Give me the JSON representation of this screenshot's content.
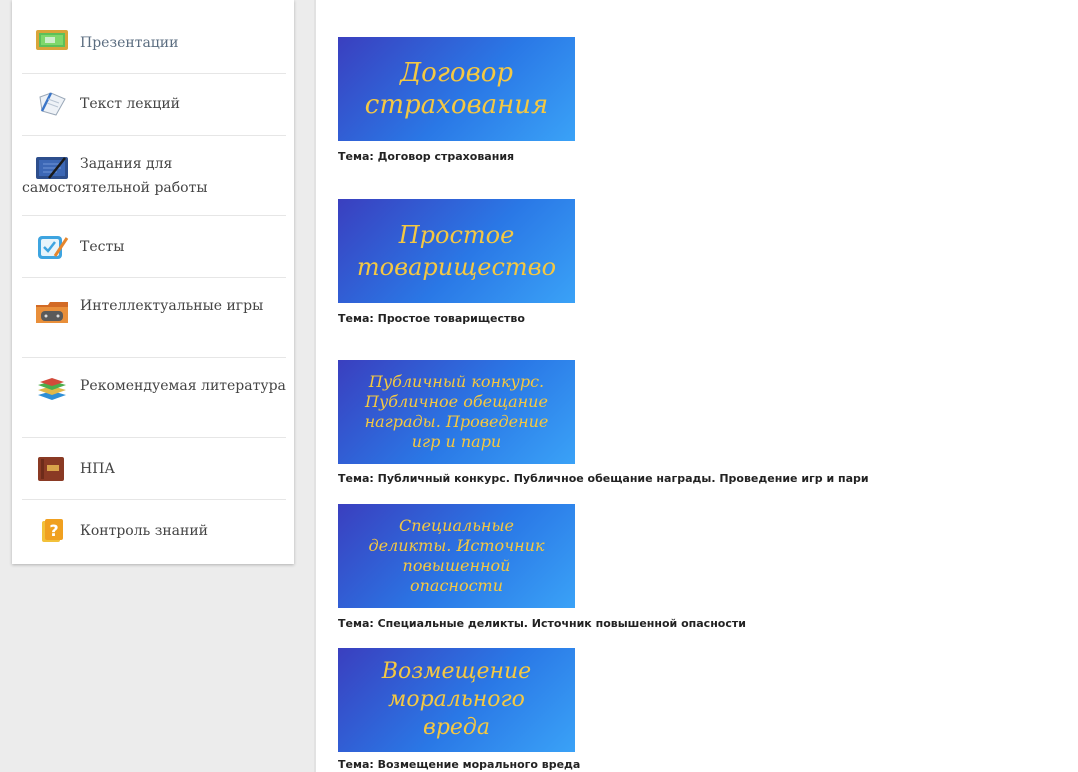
{
  "sidebar": {
    "items": [
      {
        "label": "Презентации",
        "icon": "presentation-icon"
      },
      {
        "label": "Текст лекций",
        "icon": "notebook-icon"
      },
      {
        "label": "Задания для самостоятельной работы",
        "icon": "tasks-icon"
      },
      {
        "label": "Тесты",
        "icon": "checklist-icon"
      },
      {
        "label": "Интеллектуальные игры",
        "icon": "gamepad-folder-icon"
      },
      {
        "label": "Рекомендуемая литература",
        "icon": "books-icon"
      },
      {
        "label": "НПА",
        "icon": "law-book-icon"
      },
      {
        "label": "Контроль знаний",
        "icon": "question-icon"
      }
    ]
  },
  "topics": [
    {
      "cover": "Договор\nстрахования",
      "caption": "Тема: Договор страхования"
    },
    {
      "cover": "Простое\nтоварищество",
      "caption": "Тема: Простое товарищество"
    },
    {
      "cover": "Публичный конкурс.\nПубличное обещание\nнаграды. Проведение\nигр и пари",
      "caption": "Тема: Публичный конкурс. Публичное обещание награды. Проведение игр и пари"
    },
    {
      "cover": "Специальные\nделикты. Источник\nповышенной\nопасности",
      "caption": "Тема: Специальные деликты. Источник повышенной опасности"
    },
    {
      "cover": "Возмещение\nморального\nвреда",
      "caption": "Тема: Возмещение морального вреда"
    }
  ],
  "colors": {
    "cover_text": "#f4c842",
    "active_menu_text": "#5b6d80",
    "menu_text": "#444444"
  }
}
